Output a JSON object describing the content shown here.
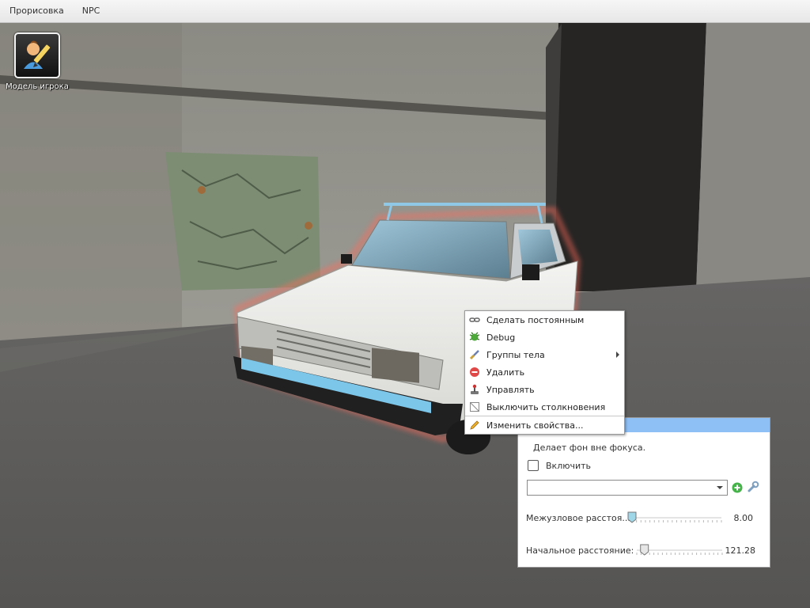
{
  "menubar": {
    "items": [
      "Прорисовка",
      "NPC"
    ]
  },
  "desktop": {
    "player_model_label": "Модель игрока"
  },
  "context_menu": {
    "items": [
      {
        "label": "Сделать постоянным",
        "icon": "link-icon",
        "submenu": false
      },
      {
        "label": "Debug",
        "icon": "bug-icon",
        "submenu": false
      },
      {
        "label": "Группы тела",
        "icon": "brush-icon",
        "submenu": true
      },
      {
        "label": "Удалить",
        "icon": "delete-icon",
        "submenu": false
      },
      {
        "label": "Управлять",
        "icon": "joystick-icon",
        "submenu": false
      },
      {
        "label": "Выключить столкновения",
        "icon": "collision-off-icon",
        "submenu": false
      },
      {
        "label": "Изменить свойства...",
        "icon": "pencil-icon",
        "submenu": false
      }
    ]
  },
  "panel": {
    "description": "Делает фон вне фокуса.",
    "enable_label": "Включить",
    "enable_checked": false,
    "combo_value": "",
    "sliders": [
      {
        "label": "Межузловое расстоя...",
        "value_text": "8.00",
        "fraction": 0.0
      },
      {
        "label": "Начальное расстояние:",
        "value_text": "121.28",
        "fraction": 0.09
      }
    ]
  },
  "colors": {
    "panel_titlebar": "#8ebff5",
    "car_outline": "#ff6a5a",
    "menubar_bg": "#ececec"
  }
}
